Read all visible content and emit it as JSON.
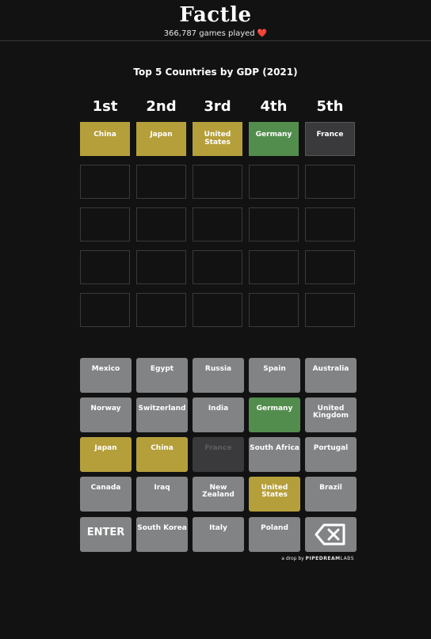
{
  "header": {
    "title": "Factle",
    "games_played": "366,787 games played",
    "heart_icon": "heart-icon"
  },
  "prompt": "Top 5 Countries by GDP (2021)",
  "columns": [
    "1st",
    "2nd",
    "3rd",
    "4th",
    "5th"
  ],
  "board": [
    [
      {
        "text": "China",
        "state": "yellow"
      },
      {
        "text": "Japan",
        "state": "yellow"
      },
      {
        "text": "United States",
        "state": "yellow"
      },
      {
        "text": "Germany",
        "state": "green"
      },
      {
        "text": "France",
        "state": "gray"
      }
    ],
    [
      {
        "text": "",
        "state": "empty"
      },
      {
        "text": "",
        "state": "empty"
      },
      {
        "text": "",
        "state": "empty"
      },
      {
        "text": "",
        "state": "empty"
      },
      {
        "text": "",
        "state": "empty"
      }
    ],
    [
      {
        "text": "",
        "state": "empty"
      },
      {
        "text": "",
        "state": "empty"
      },
      {
        "text": "",
        "state": "empty"
      },
      {
        "text": "",
        "state": "empty"
      },
      {
        "text": "",
        "state": "empty"
      }
    ],
    [
      {
        "text": "",
        "state": "empty"
      },
      {
        "text": "",
        "state": "empty"
      },
      {
        "text": "",
        "state": "empty"
      },
      {
        "text": "",
        "state": "empty"
      },
      {
        "text": "",
        "state": "empty"
      }
    ],
    [
      {
        "text": "",
        "state": "empty"
      },
      {
        "text": "",
        "state": "empty"
      },
      {
        "text": "",
        "state": "empty"
      },
      {
        "text": "",
        "state": "empty"
      },
      {
        "text": "",
        "state": "empty"
      }
    ]
  ],
  "keyboard": [
    [
      {
        "label": "Mexico",
        "state": "default"
      },
      {
        "label": "Egypt",
        "state": "default"
      },
      {
        "label": "Russia",
        "state": "default"
      },
      {
        "label": "Spain",
        "state": "default"
      },
      {
        "label": "Australia",
        "state": "default"
      }
    ],
    [
      {
        "label": "Norway",
        "state": "default"
      },
      {
        "label": "Switzerland",
        "state": "default"
      },
      {
        "label": "India",
        "state": "default"
      },
      {
        "label": "Germany",
        "state": "green"
      },
      {
        "label": "United Kingdom",
        "state": "default"
      }
    ],
    [
      {
        "label": "Japan",
        "state": "yellow"
      },
      {
        "label": "China",
        "state": "yellow"
      },
      {
        "label": "France",
        "state": "dark"
      },
      {
        "label": "South Africa",
        "state": "default"
      },
      {
        "label": "Portugal",
        "state": "default"
      }
    ],
    [
      {
        "label": "Canada",
        "state": "default"
      },
      {
        "label": "Iraq",
        "state": "default"
      },
      {
        "label": "New Zealand",
        "state": "default"
      },
      {
        "label": "United States",
        "state": "yellow"
      },
      {
        "label": "Brazil",
        "state": "default"
      }
    ],
    [
      {
        "label": "ENTER",
        "state": "enter"
      },
      {
        "label": "South Korea",
        "state": "default"
      },
      {
        "label": "Italy",
        "state": "default"
      },
      {
        "label": "Poland",
        "state": "default"
      },
      {
        "label": "",
        "state": "back",
        "icon": "backspace-icon"
      }
    ]
  ],
  "credit": {
    "prefix": "a drop by",
    "brand_a": "PIPEDREAM",
    "brand_b": "LABS"
  },
  "colors": {
    "background": "#121213",
    "correct": "#538d4e",
    "present": "#b59f3b",
    "absent": "#3a3a3c",
    "key": "#818384"
  }
}
